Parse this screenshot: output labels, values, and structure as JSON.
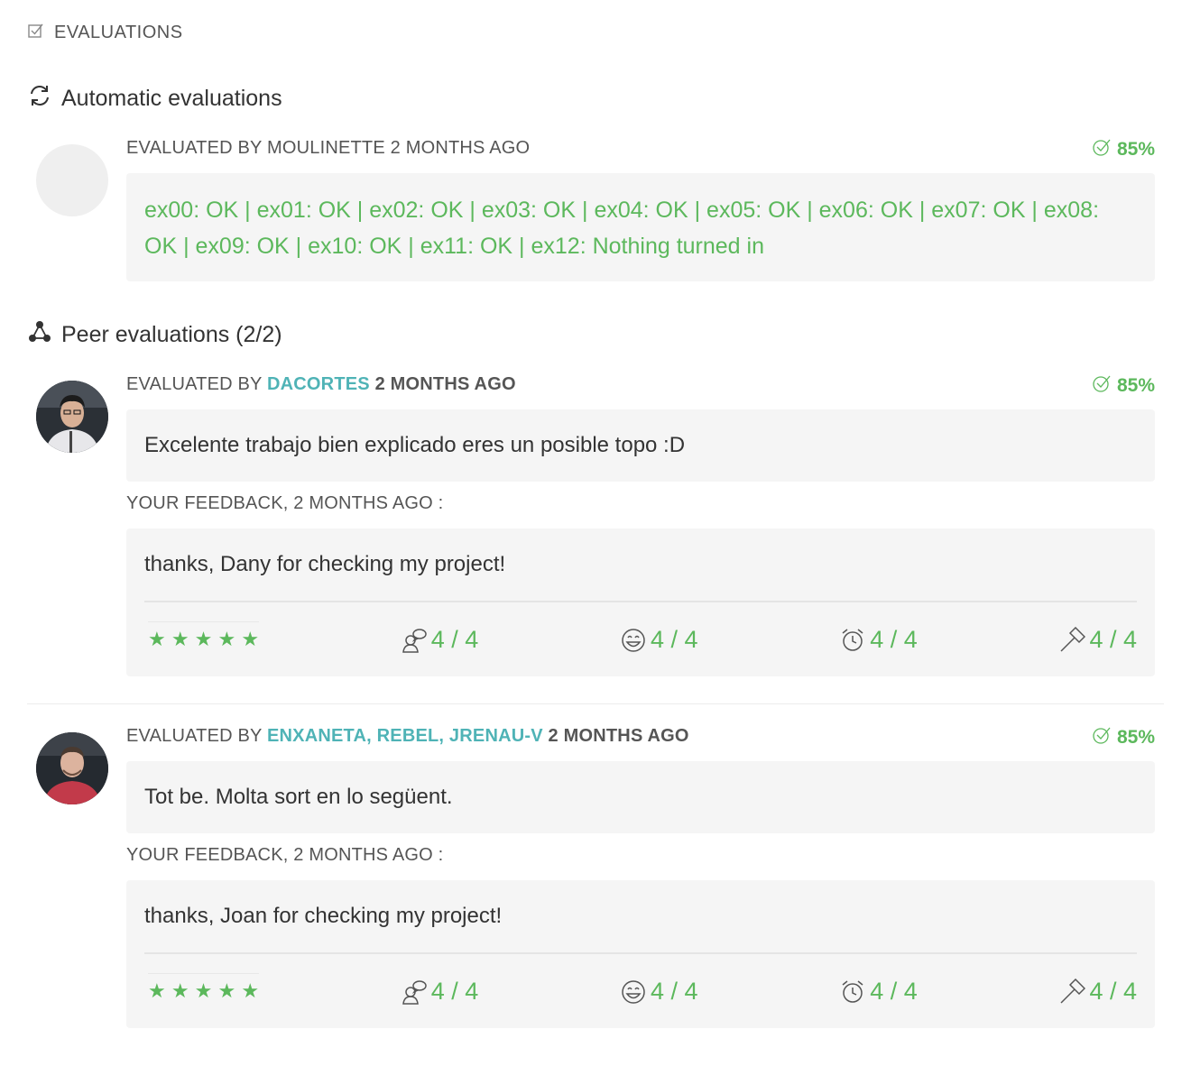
{
  "header": {
    "title": "EVALUATIONS"
  },
  "automatic": {
    "heading": "Automatic evaluations",
    "evaluated_by": "EVALUATED BY MOULINETTE 2 MONTHS AGO",
    "score": "85%",
    "result_text": "ex00: OK | ex01: OK | ex02: OK | ex03: OK | ex04: OK | ex05: OK | ex06: OK | ex07: OK | ex08: OK | ex09: OK | ex10: OK | ex11: OK | ex12: Nothing turned in"
  },
  "peer": {
    "heading": "Peer evaluations (2/2)",
    "evaluations": [
      {
        "prefix": "EVALUATED BY ",
        "evaluators": "DACORTES",
        "time": "2 MONTHS AGO",
        "score": "85%",
        "comment": "Excelente trabajo bien explicado eres un posible topo :D",
        "feedback_label": "YOUR FEEDBACK, 2 MONTHS AGO :",
        "feedback": "thanks, Dany for checking my project!",
        "stars": "★ ★ ★ ★ ★",
        "ratings": [
          "4 / 4",
          "4 / 4",
          "4 / 4",
          "4 / 4"
        ]
      },
      {
        "prefix": "EVALUATED BY ",
        "evaluators": "ENXANETA, REBEL, JRENAU-V",
        "time": "2 MONTHS AGO",
        "score": "85%",
        "comment": "Tot be. Molta sort en lo següent.",
        "feedback_label": "YOUR FEEDBACK, 2 MONTHS AGO :",
        "feedback": "thanks, Joan for checking my project!",
        "stars": "★ ★ ★ ★ ★",
        "ratings": [
          "4 / 4",
          "4 / 4",
          "4 / 4",
          "4 / 4"
        ]
      }
    ]
  },
  "colors": {
    "accent_green": "#5cb85c",
    "link_teal": "#4fb3b6",
    "box_bg": "#f5f5f5"
  },
  "icons": {
    "rating_icons": [
      "chat-person-icon",
      "smiley-icon",
      "alarm-clock-icon",
      "hammer-icon"
    ]
  }
}
